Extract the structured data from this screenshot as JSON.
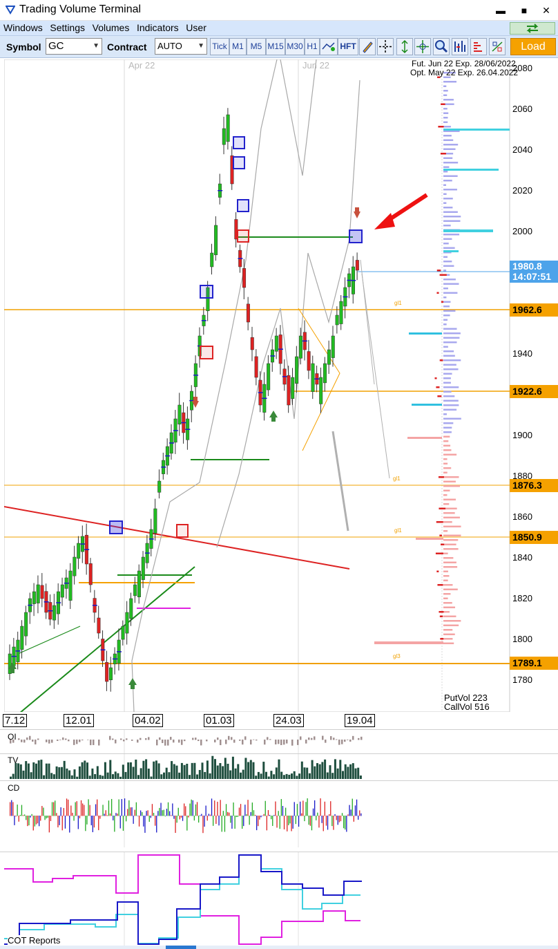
{
  "window": {
    "title": "Trading Volume Terminal",
    "minimize": "▬",
    "maximize": "■",
    "close": "✕"
  },
  "menu": [
    "Windows",
    "Settings",
    "Volumes",
    "Indicators",
    "User"
  ],
  "toolbar": {
    "symbol_label": "Symbol",
    "symbol_value": "GC",
    "contract_label": "Contract",
    "contract_value": "AUTO",
    "timeframes": [
      "Tick",
      "M1",
      "M5",
      "M15",
      "M30",
      "H1"
    ],
    "hft_label": "HFT",
    "load_label": "Load"
  },
  "chart": {
    "info_line1": "Fut. Jun 22 Exp. 28/06/2022",
    "info_line2": "Opt. May 22 Exp. 26.04.2022",
    "month_labels": [
      "Apr 22",
      "Jun 22"
    ],
    "price_axis": [
      "2080",
      "2060",
      "2040",
      "2020",
      "2000",
      "1980",
      "1960",
      "1940",
      "1920",
      "1900",
      "1880",
      "1860",
      "1840",
      "1820",
      "1800",
      "1780"
    ],
    "current_price": "1980.8",
    "current_time": "14:07:51",
    "levels": [
      "1962.6",
      "1922.6",
      "1876.3",
      "1850.9",
      "1789.1"
    ],
    "level_marks": [
      "gl1",
      "gl1",
      "gl1",
      "gl3"
    ],
    "put_vol": "PutVol  223",
    "call_vol": "CallVol  516",
    "dates": [
      "7.12",
      "12.01",
      "04.02",
      "01.03",
      "24.03",
      "19.04"
    ]
  },
  "panels": {
    "oi": "OI",
    "tv": "TV",
    "cd": "CD",
    "cot": "COT Reports"
  },
  "colors": {
    "accent_orange": "#f5a100",
    "bull": "#22bb22",
    "bear": "#dd2222",
    "level": "#f0a000",
    "price_tag": "#4da3ea"
  }
}
